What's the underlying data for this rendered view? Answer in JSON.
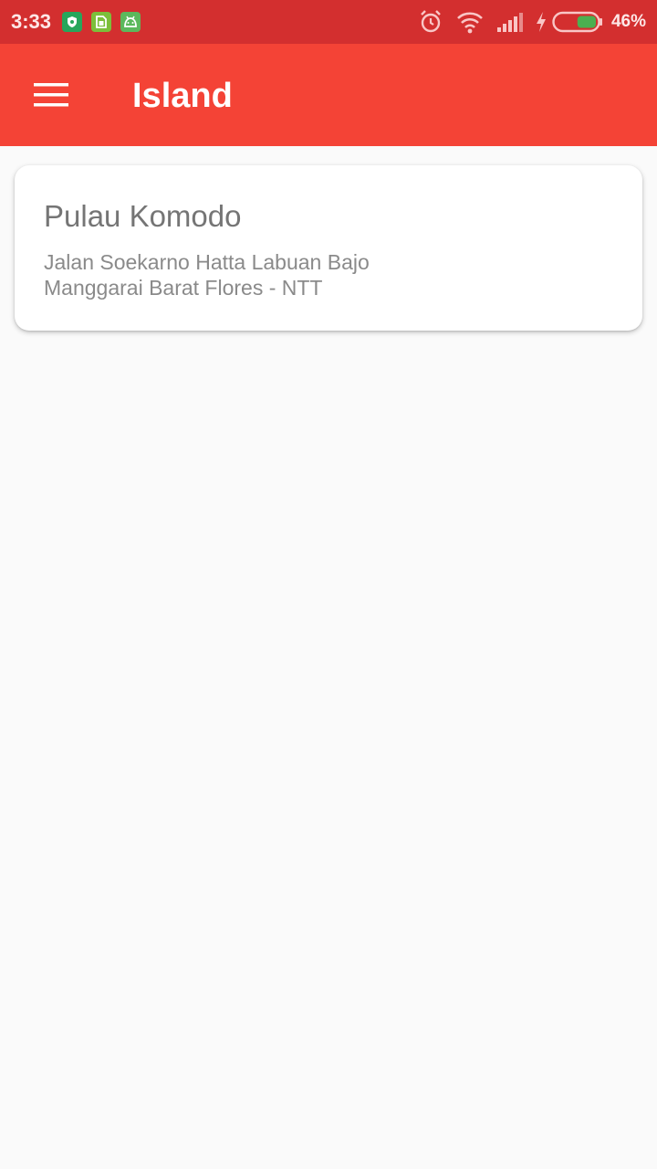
{
  "status_bar": {
    "time": "3:33",
    "battery_percent": "46%",
    "battery_level": 0.46,
    "notification_icons": [
      "shield-app-icon",
      "sim-card-icon",
      "android-icon"
    ],
    "system_icons": [
      "alarm-icon",
      "wifi-icon",
      "signal-icon",
      "charging-icon",
      "battery-icon"
    ],
    "colors": {
      "background": "#d32f2f",
      "battery_fill": "#4caf50"
    }
  },
  "app_bar": {
    "title": "Island",
    "menu_icon": "hamburger-menu-icon",
    "color": "#f44336"
  },
  "list": {
    "items": [
      {
        "title": "Pulau Komodo",
        "address_line_1": "Jalan Soekarno Hatta Labuan Bajo",
        "address_line_2": "Manggarai Barat Flores - NTT"
      }
    ]
  }
}
